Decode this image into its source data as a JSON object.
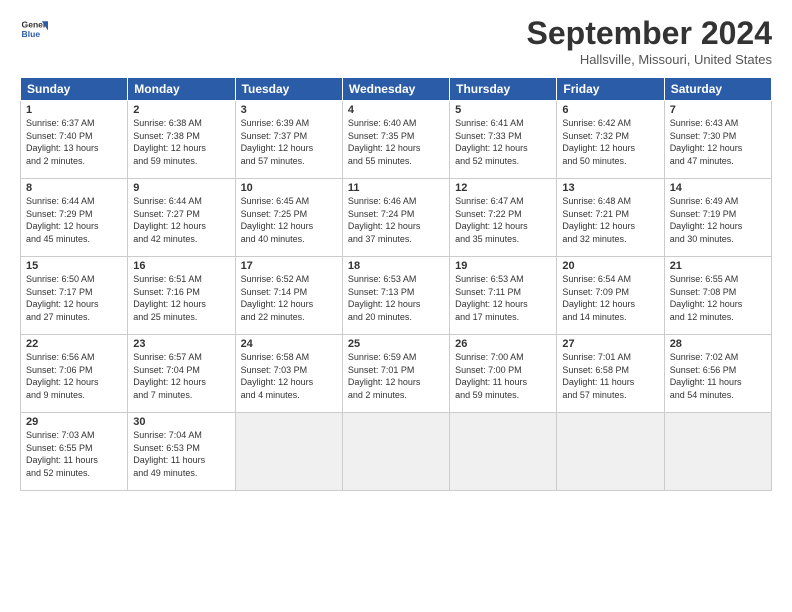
{
  "logo": {
    "line1": "General",
    "line2": "Blue"
  },
  "title": "September 2024",
  "location": "Hallsville, Missouri, United States",
  "weekdays": [
    "Sunday",
    "Monday",
    "Tuesday",
    "Wednesday",
    "Thursday",
    "Friday",
    "Saturday"
  ],
  "weeks": [
    [
      {
        "day": "1",
        "rise": "6:37 AM",
        "set": "7:40 PM",
        "daylight": "13 hours and 2 minutes."
      },
      {
        "day": "2",
        "rise": "6:38 AM",
        "set": "7:38 PM",
        "daylight": "12 hours and 59 minutes."
      },
      {
        "day": "3",
        "rise": "6:39 AM",
        "set": "7:37 PM",
        "daylight": "12 hours and 57 minutes."
      },
      {
        "day": "4",
        "rise": "6:40 AM",
        "set": "7:35 PM",
        "daylight": "12 hours and 55 minutes."
      },
      {
        "day": "5",
        "rise": "6:41 AM",
        "set": "7:33 PM",
        "daylight": "12 hours and 52 minutes."
      },
      {
        "day": "6",
        "rise": "6:42 AM",
        "set": "7:32 PM",
        "daylight": "12 hours and 50 minutes."
      },
      {
        "day": "7",
        "rise": "6:43 AM",
        "set": "7:30 PM",
        "daylight": "12 hours and 47 minutes."
      }
    ],
    [
      {
        "day": "8",
        "rise": "6:44 AM",
        "set": "7:29 PM",
        "daylight": "12 hours and 45 minutes."
      },
      {
        "day": "9",
        "rise": "6:44 AM",
        "set": "7:27 PM",
        "daylight": "12 hours and 42 minutes."
      },
      {
        "day": "10",
        "rise": "6:45 AM",
        "set": "7:25 PM",
        "daylight": "12 hours and 40 minutes."
      },
      {
        "day": "11",
        "rise": "6:46 AM",
        "set": "7:24 PM",
        "daylight": "12 hours and 37 minutes."
      },
      {
        "day": "12",
        "rise": "6:47 AM",
        "set": "7:22 PM",
        "daylight": "12 hours and 35 minutes."
      },
      {
        "day": "13",
        "rise": "6:48 AM",
        "set": "7:21 PM",
        "daylight": "12 hours and 32 minutes."
      },
      {
        "day": "14",
        "rise": "6:49 AM",
        "set": "7:19 PM",
        "daylight": "12 hours and 30 minutes."
      }
    ],
    [
      {
        "day": "15",
        "rise": "6:50 AM",
        "set": "7:17 PM",
        "daylight": "12 hours and 27 minutes."
      },
      {
        "day": "16",
        "rise": "6:51 AM",
        "set": "7:16 PM",
        "daylight": "12 hours and 25 minutes."
      },
      {
        "day": "17",
        "rise": "6:52 AM",
        "set": "7:14 PM",
        "daylight": "12 hours and 22 minutes."
      },
      {
        "day": "18",
        "rise": "6:53 AM",
        "set": "7:13 PM",
        "daylight": "12 hours and 20 minutes."
      },
      {
        "day": "19",
        "rise": "6:53 AM",
        "set": "7:11 PM",
        "daylight": "12 hours and 17 minutes."
      },
      {
        "day": "20",
        "rise": "6:54 AM",
        "set": "7:09 PM",
        "daylight": "12 hours and 14 minutes."
      },
      {
        "day": "21",
        "rise": "6:55 AM",
        "set": "7:08 PM",
        "daylight": "12 hours and 12 minutes."
      }
    ],
    [
      {
        "day": "22",
        "rise": "6:56 AM",
        "set": "7:06 PM",
        "daylight": "12 hours and 9 minutes."
      },
      {
        "day": "23",
        "rise": "6:57 AM",
        "set": "7:04 PM",
        "daylight": "12 hours and 7 minutes."
      },
      {
        "day": "24",
        "rise": "6:58 AM",
        "set": "7:03 PM",
        "daylight": "12 hours and 4 minutes."
      },
      {
        "day": "25",
        "rise": "6:59 AM",
        "set": "7:01 PM",
        "daylight": "12 hours and 2 minutes."
      },
      {
        "day": "26",
        "rise": "7:00 AM",
        "set": "7:00 PM",
        "daylight": "11 hours and 59 minutes."
      },
      {
        "day": "27",
        "rise": "7:01 AM",
        "set": "6:58 PM",
        "daylight": "11 hours and 57 minutes."
      },
      {
        "day": "28",
        "rise": "7:02 AM",
        "set": "6:56 PM",
        "daylight": "11 hours and 54 minutes."
      }
    ],
    [
      {
        "day": "29",
        "rise": "7:03 AM",
        "set": "6:55 PM",
        "daylight": "11 hours and 52 minutes."
      },
      {
        "day": "30",
        "rise": "7:04 AM",
        "set": "6:53 PM",
        "daylight": "11 hours and 49 minutes."
      },
      null,
      null,
      null,
      null,
      null
    ]
  ]
}
